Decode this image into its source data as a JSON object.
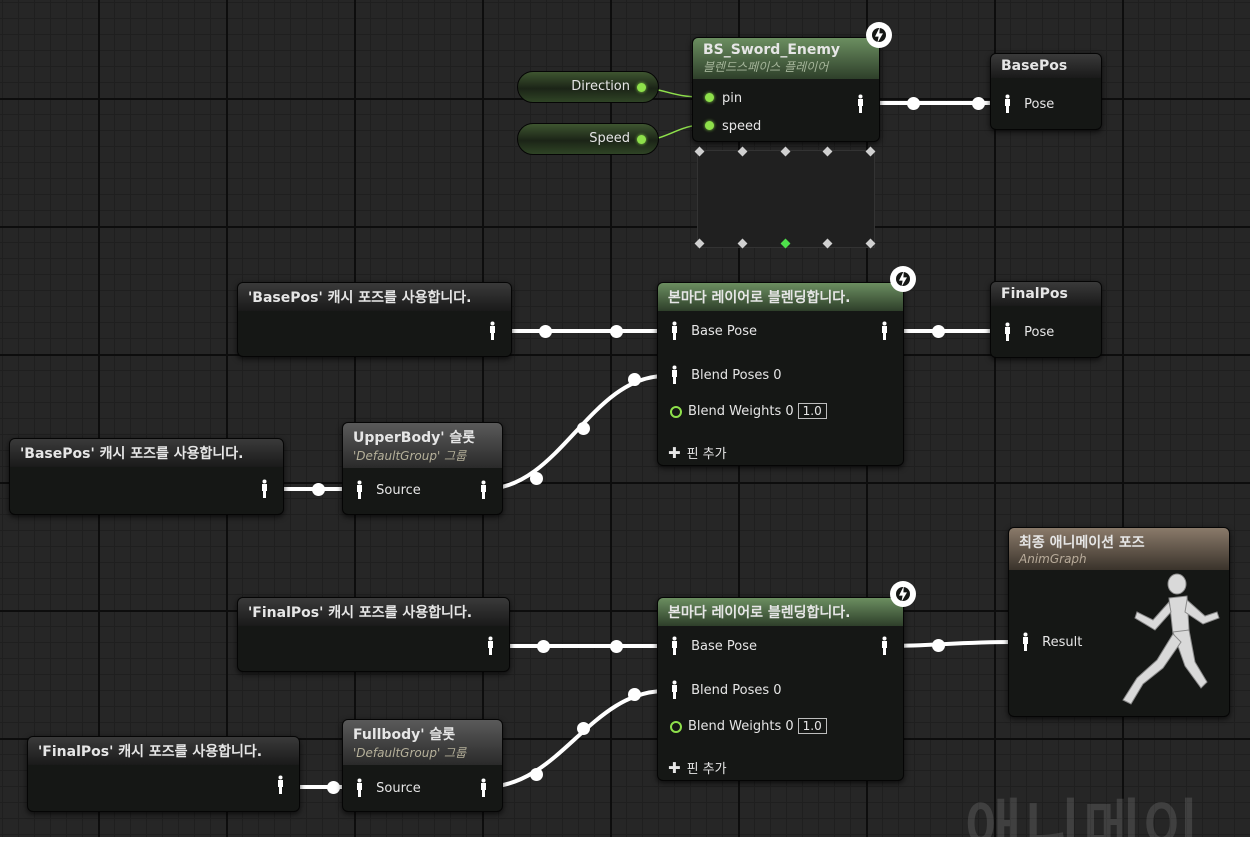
{
  "blendspace": {
    "title": "BS_Sword_Enemy",
    "subtitle": "블렌드스페이스 플레이어",
    "pins": [
      "pin",
      "speed"
    ]
  },
  "variables": {
    "direction": "Direction",
    "speed": "Speed"
  },
  "save_pose_basepos": {
    "title": "BasePos",
    "pin": "Pose"
  },
  "save_pose_finalpos": {
    "title": "FinalPos",
    "pin": "Pose"
  },
  "use_cache_basepos": "'BasePos' 캐시 포즈를 사용합니다.",
  "use_cache_finalpos": "'FinalPos' 캐시 포즈를 사용합니다.",
  "layered_blend_title": "본마다 레이어로 블렌딩합니다.",
  "layered_blend": {
    "base_pose": "Base Pose",
    "blend_poses": "Blend Poses 0",
    "blend_weights": "Blend Weights 0",
    "weight_value": "1.0",
    "add_pin": "핀 추가"
  },
  "slot_upper": {
    "title": "UpperBody' 슬롯",
    "group": "'DefaultGroup' 그룹",
    "pin": "Source"
  },
  "slot_full": {
    "title": "Fullbody' 슬롯",
    "group": "'DefaultGroup' 그룹",
    "pin": "Source"
  },
  "final_pose": {
    "title": "최종 애니메이션 포즈",
    "subtitle": "AnimGraph",
    "pin": "Result"
  },
  "watermark": "애니메이",
  "colors": {
    "exec_green": "#8ee04b",
    "pose_wire": "#ffffff",
    "header_green": "#6b8e60"
  }
}
